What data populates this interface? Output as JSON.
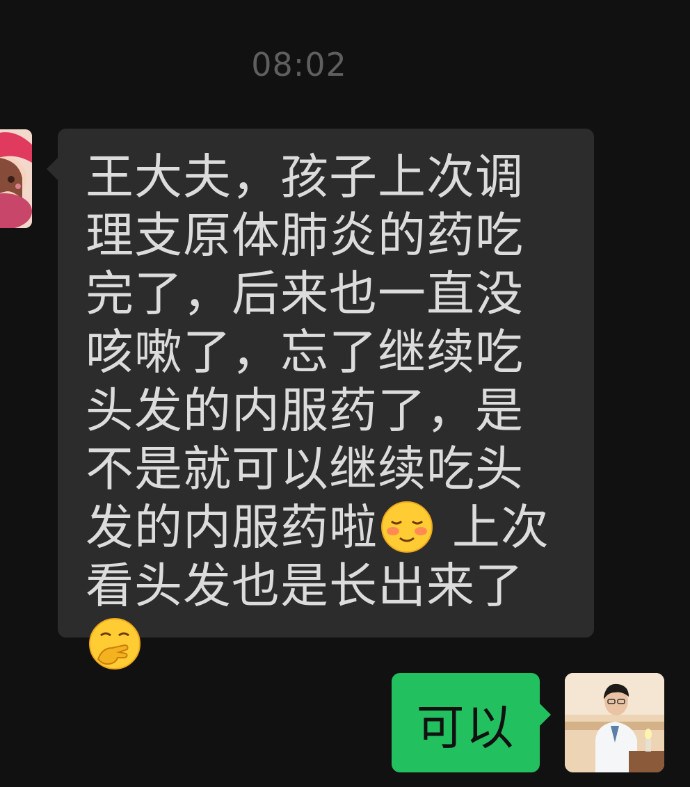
{
  "chat": {
    "timestamp": "08:02",
    "incoming": {
      "lines": [
        "王大夫，孩子上次调理支原体肺炎的药吃完了，后来也一直没咳嗽了，忘了继续吃头发的内服药了，是不是就可以继续吃头发的内服药啦"
      ],
      "after_emoji_1": " 上次看头发也是长出来了",
      "emoji_1": "blushing-smile-emoji",
      "emoji_2": "hand-over-mouth-emoji"
    },
    "outgoing": {
      "text": "可以"
    }
  },
  "colors": {
    "background": "#111111",
    "incoming_bubble": "#2c2c2c",
    "outgoing_bubble": "#23c05f"
  }
}
